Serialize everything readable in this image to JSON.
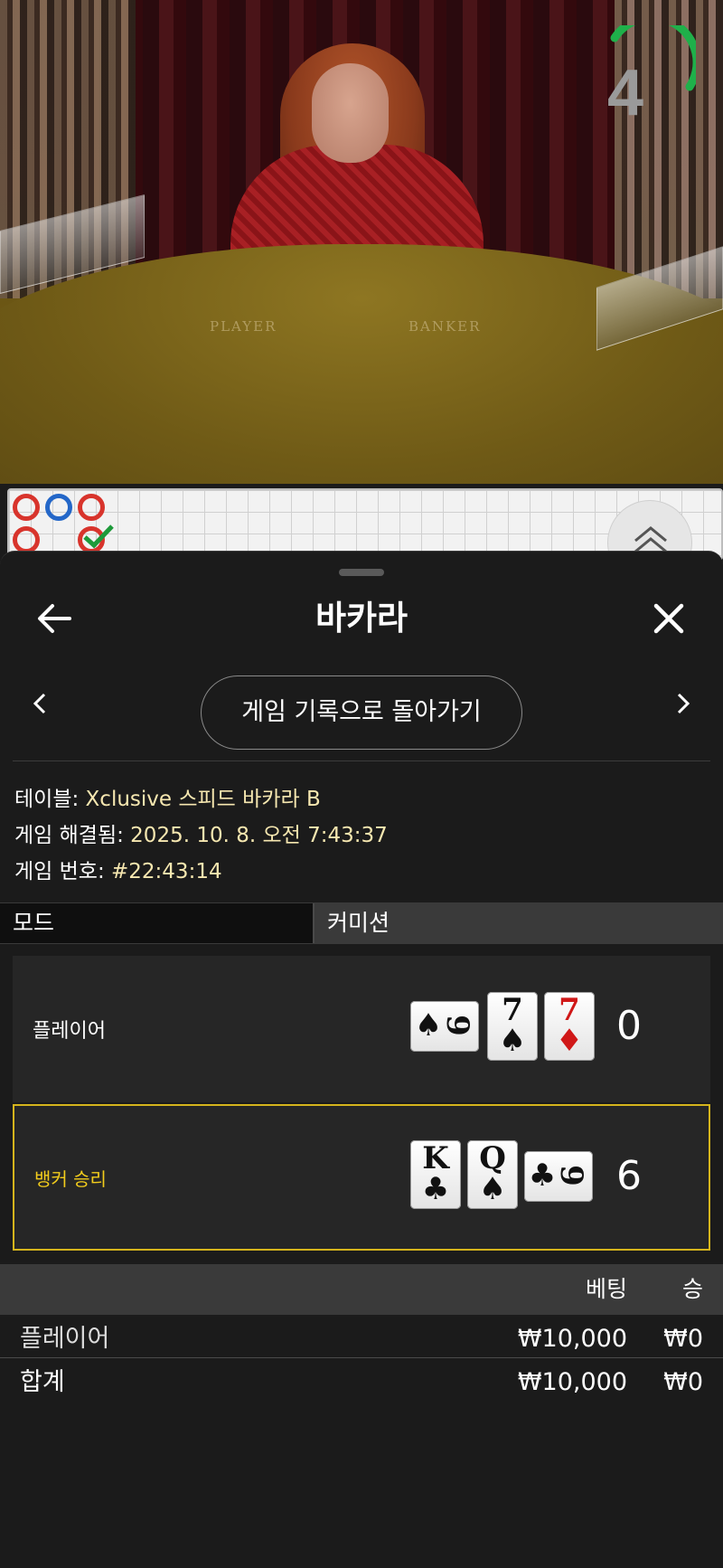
{
  "video": {
    "felt_player": "PLAYER",
    "felt_banker": "BANKER",
    "countdown": "4"
  },
  "sheet": {
    "title": "바카라",
    "back_to_history": "게임 기록으로 돌아가기"
  },
  "info": {
    "table_label": "테이블: ",
    "table_value": "Xclusive 스피드 바카라 B",
    "resolved_label": "게임 해결됨: ",
    "resolved_value": "2025. 10. 8. 오전 7:43:37",
    "game_no_label": "게임 번호: ",
    "game_no_value": "#22:43:14"
  },
  "tabs": [
    {
      "label": "모드",
      "active": true
    },
    {
      "label": "커미션",
      "active": false
    }
  ],
  "results": {
    "player": {
      "label": "플레이어",
      "score": "0",
      "cards": [
        {
          "rank": "9",
          "suit": "♠",
          "color": "#111111",
          "orientation": "sideways"
        },
        {
          "rank": "7",
          "suit": "♠",
          "color": "#111111",
          "orientation": "upright"
        },
        {
          "rank": "7",
          "suit": "♦",
          "color": "#d01818",
          "orientation": "upright"
        }
      ]
    },
    "banker": {
      "label": "뱅커 승리",
      "score": "6",
      "cards": [
        {
          "rank": "K",
          "suit": "♣",
          "color": "#111111",
          "orientation": "upright"
        },
        {
          "rank": "Q",
          "suit": "♠",
          "color": "#111111",
          "orientation": "upright"
        },
        {
          "rank": "9",
          "suit": "♣",
          "color": "#111111",
          "orientation": "sideways"
        }
      ]
    },
    "win_color": "#f2cc1c"
  },
  "bets": {
    "col_bet": "베팅",
    "col_win": "승",
    "rows": [
      {
        "name": "플레이어",
        "bet": "₩10,000",
        "win": "₩0"
      }
    ],
    "total": {
      "name": "합계",
      "bet": "₩10,000",
      "win": "₩0"
    }
  },
  "colors": {
    "accent_yellow": "#d5b41c",
    "info_value": "#f6e7b0",
    "road_red": "#d8342c",
    "road_blue": "#2467c8",
    "road_green": "#1e9a3a",
    "timer_green": "#1fb04a"
  }
}
